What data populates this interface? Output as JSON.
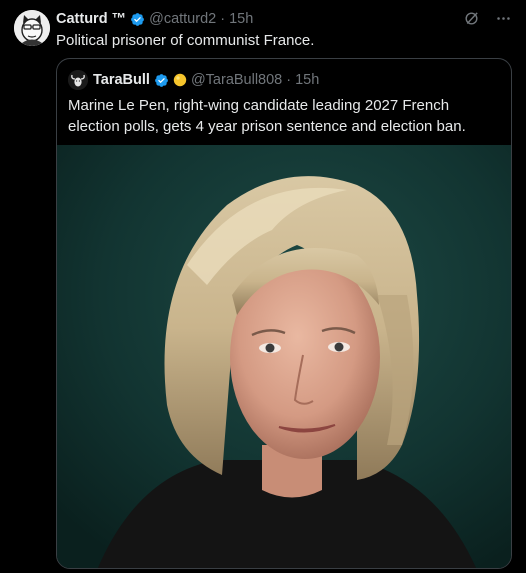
{
  "tweet": {
    "author": {
      "name": "Catturd ™",
      "handle": "@catturd2",
      "time": "15h",
      "avatar": "cartoon-cat-avatar",
      "verified_color": "#1d9bf0"
    },
    "text": "Political prisoner of communist France.",
    "icons": [
      "grok-icon",
      "more-icon"
    ]
  },
  "quote": {
    "author": {
      "name": "TaraBull",
      "handle": "@TaraBull808",
      "time": "15h",
      "avatar": "tara-bull-avatar",
      "verified_color": "#1d9bf0",
      "extra_badge": "yellow-circle-emoji"
    },
    "text": "Marine Le Pen, right-wing candidate leading 2027 French election polls, gets 4 year prison sentence and election ban.",
    "image": "portrait-photo"
  },
  "separator": "·",
  "colors": {
    "background": "#000000",
    "text": "#e7e9ea",
    "secondary": "#71767b",
    "border": "#3a3f44",
    "accent": "#1d9bf0"
  }
}
